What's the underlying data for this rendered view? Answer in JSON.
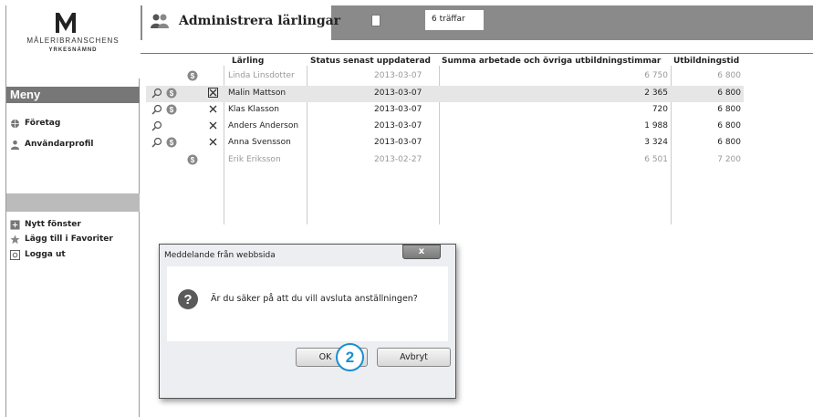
{
  "logo": {
    "name": "MÅLERIBRANSCHENS",
    "sub": "YRKESNÄMND"
  },
  "sidebar": {
    "menu_header": "Meny",
    "items": [
      {
        "label": "Företag",
        "icon": "globe-icon"
      },
      {
        "label": "Användarprofil",
        "icon": "user-icon"
      }
    ],
    "bottom_items": [
      {
        "label": "Nytt fönster",
        "icon": "new-window-icon"
      },
      {
        "label": "Lägg till i Favoriter",
        "icon": "star-icon"
      },
      {
        "label": "Logga ut",
        "icon": "logout-icon"
      }
    ]
  },
  "header": {
    "title": "Administrera lärlingar",
    "hits": "6 träffar"
  },
  "table": {
    "columns": [
      "Lärling",
      "Status senast uppdaterad",
      "Summa arbetade och övriga utbildningstimmar",
      "Utbildningstid"
    ],
    "rows": [
      {
        "name": "Linda Linsdotter",
        "date": "2013-03-07",
        "hours": "6 750",
        "time": "6 800",
        "dim": true,
        "search": false,
        "money": true,
        "remove": false
      },
      {
        "name": "Malin Mattson",
        "date": "2013-03-07",
        "hours": "2 365",
        "time": "6 800",
        "dim": false,
        "search": true,
        "money": true,
        "remove": true
      },
      {
        "name": "Klas Klasson",
        "date": "2013-03-07",
        "hours": "720",
        "time": "6 800",
        "dim": false,
        "search": true,
        "money": true,
        "remove": true
      },
      {
        "name": "Anders Anderson",
        "date": "2013-03-07",
        "hours": "1 988",
        "time": "6 800",
        "dim": false,
        "search": true,
        "money": false,
        "remove": true
      },
      {
        "name": "Anna Svensson",
        "date": "2013-03-07",
        "hours": "3 324",
        "time": "6 800",
        "dim": false,
        "search": true,
        "money": true,
        "remove": true
      },
      {
        "name": "Erik Eriksson",
        "date": "2013-02-27",
        "hours": "6 501",
        "time": "7 200",
        "dim": true,
        "search": false,
        "money": true,
        "remove": false
      }
    ]
  },
  "dialog": {
    "title": "Meddelande från webbsida",
    "close": "x",
    "message": "Är du säker på att du vill avsluta anställningen?",
    "ok": "OK",
    "cancel": "Avbryt"
  },
  "callout": "2",
  "colors": {
    "topbar": "#8a8a8a",
    "menu_header": "#777777",
    "callout": "#1a8fd0"
  }
}
